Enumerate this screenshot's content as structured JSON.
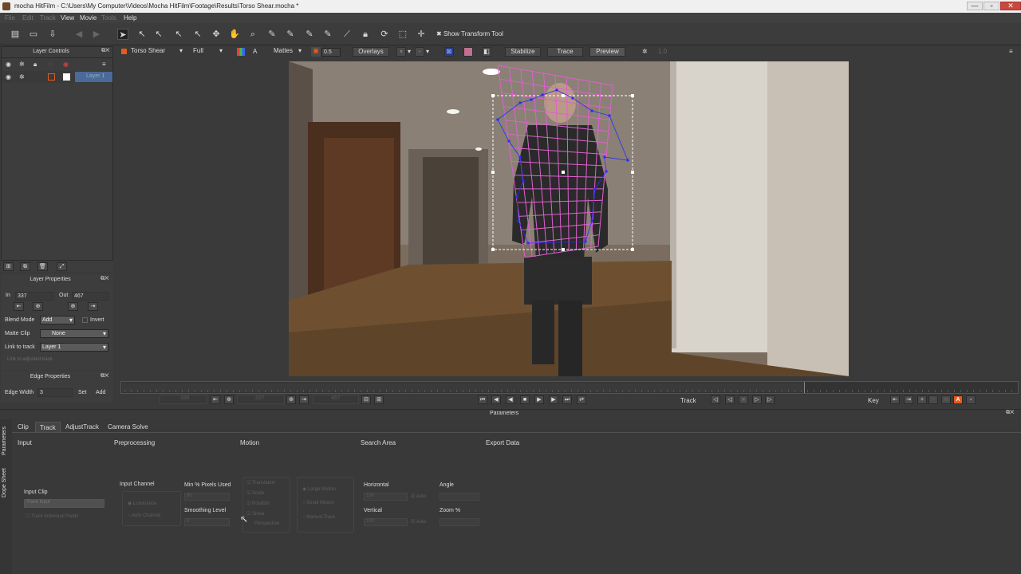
{
  "window": {
    "title": "mocha HitFilm - C:\\Users\\My Computer\\Videos\\Mocha HitFilm\\Footage\\Results\\Torso Shear.mocha *",
    "minimize": "—",
    "maximize": "▫",
    "close": "✕"
  },
  "menu": {
    "items": [
      "File",
      "Edit",
      "Track",
      "View",
      "Movie",
      "Tools",
      "Help"
    ]
  },
  "toolbar": {
    "show_transform_label": "Show Transform Tool",
    "show_transform_checked": true
  },
  "viewer_toolbar": {
    "layer_select": "Torso Shear",
    "quality_select": "Full",
    "mattes_label": "Mattes",
    "opacity_value": "0.5",
    "overlays_label": "Overlays",
    "stabilize_label": "Stabilize",
    "trace_label": "Trace",
    "preview_label": "Preview",
    "zoom_value": "1.0"
  },
  "layer_controls": {
    "title": "Layer Controls",
    "layers": [
      {
        "name": "Layer 1",
        "color": "#e85a1a"
      }
    ]
  },
  "layer_properties": {
    "title": "Layer Properties",
    "in_label": "In",
    "in_value": "337",
    "out_label": "Out",
    "out_value": "467",
    "blend_mode_label": "Blend Mode",
    "blend_mode_value": "Add",
    "invert_label": "Invert",
    "matte_clip_label": "Matte Clip",
    "matte_clip_value": "None",
    "link_to_track_label": "Link to track",
    "link_to_track_value": "Layer 1",
    "link_adjusted_label": "Link to adjusted track"
  },
  "edge_properties": {
    "title": "Edge Properties",
    "edge_width_label": "Edge Width",
    "edge_width_value": "3",
    "set_label": "Set",
    "add_label": "Add"
  },
  "transport": {
    "frame_start": "336",
    "frame_current": "337",
    "frame_end": "467",
    "track_label": "Track",
    "key_label": "Key"
  },
  "parameters": {
    "title": "Parameters",
    "tabs": [
      "Clip",
      "Track",
      "AdjustTrack",
      "Camera Solve"
    ],
    "active_tab": "Track",
    "side_tabs": [
      "Parameters",
      "Dope Sheet"
    ],
    "sections": {
      "input": "Input",
      "preprocessing": "Preprocessing",
      "motion": "Motion",
      "search_area": "Search Area",
      "export_data": "Export Data"
    },
    "input_clip_label": "Input Clip",
    "input_clip_value": "Track Input",
    "track_individual_fields": "Track Individual Fields",
    "input_channel_label": "Input Channel",
    "luminance_label": "Luminance",
    "auto_channel_label": "Auto Channel",
    "min_pixels_label": "Min % Pixels Used",
    "min_pixels_value": "90",
    "smoothing_label": "Smoothing Level",
    "smoothing_value": "0",
    "motion_options": [
      "Translation",
      "Scale",
      "Rotation",
      "Shear",
      "Perspective"
    ],
    "motion_modes": [
      "Large Motion",
      "Small Motion",
      "Manual Track"
    ],
    "horizontal_label": "Horizontal",
    "horizontal_value": "100",
    "vertical_label": "Vertical",
    "vertical_value": "100",
    "auto_label": "Auto",
    "angle_label": "Angle",
    "zoom_label": "Zoom %"
  },
  "colors": {
    "accent_orange": "#e85a1a",
    "mesh_pink": "#e060d0",
    "point_blue": "#2a2aff",
    "bg_dark": "#3a3a3a"
  }
}
